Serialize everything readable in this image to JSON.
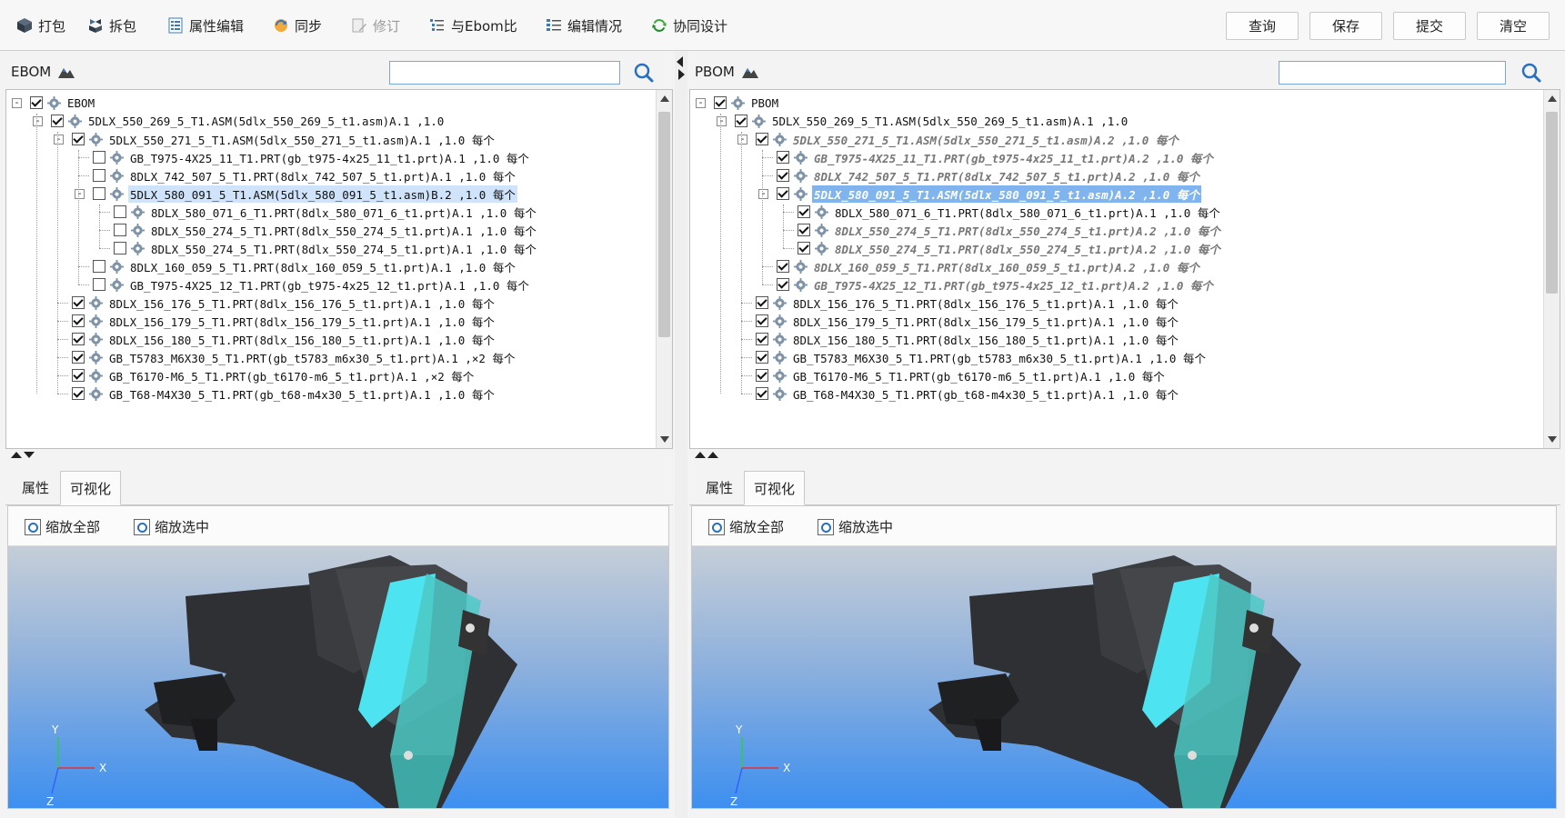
{
  "toolbar": {
    "items": [
      {
        "label": "打包",
        "icon": "package-icon"
      },
      {
        "label": "拆包",
        "icon": "unpack-icon"
      },
      {
        "label": "属性编辑",
        "icon": "property-edit-icon"
      },
      {
        "label": "同步",
        "icon": "sync-icon"
      },
      {
        "label": "修订",
        "icon": "revise-icon",
        "disabled": true
      },
      {
        "label": "与Ebom比",
        "icon": "compare-icon"
      },
      {
        "label": "编辑情况",
        "icon": "edit-status-icon"
      },
      {
        "label": "协同设计",
        "icon": "collab-icon"
      }
    ],
    "actions": {
      "query": "查询",
      "save": "保存",
      "submit": "提交",
      "clear": "清空"
    }
  },
  "left": {
    "title": "EBOM",
    "search_value": "",
    "tabs": {
      "props": "属性",
      "visual": "可视化"
    },
    "zoom_all": "缩放全部",
    "zoom_selected": "缩放选中",
    "axes": {
      "x": "X",
      "y": "Y",
      "z": "Z"
    },
    "rows": [
      {
        "text": "EBOM",
        "level": 0,
        "checked": true,
        "exp": "-"
      },
      {
        "text": "5DLX_550_269_5_T1.ASM(5dlx_550_269_5_t1.asm)A.1 ,1.0",
        "level": 1,
        "checked": true,
        "exp": "-"
      },
      {
        "text": "5DLX_550_271_5_T1.ASM(5dlx_550_271_5_t1.asm)A.1 ,1.0 每个",
        "level": 2,
        "checked": true,
        "exp": "-"
      },
      {
        "text": "GB_T975-4X25_11_T1.PRT(gb_t975-4x25_11_t1.prt)A.1 ,1.0 每个",
        "level": 3,
        "checked": false
      },
      {
        "text": "8DLX_742_507_5_T1.PRT(8dlx_742_507_5_t1.prt)A.1 ,1.0 每个",
        "level": 3,
        "checked": false
      },
      {
        "text": "5DLX_580_091_5_T1.ASM(5dlx_580_091_5_t1.asm)B.2 ,1.0 每个",
        "level": 3,
        "checked": false,
        "exp": "-",
        "selected": true
      },
      {
        "text": "8DLX_580_071_6_T1.PRT(8dlx_580_071_6_t1.prt)A.1 ,1.0 每个",
        "level": 4,
        "checked": false
      },
      {
        "text": "8DLX_550_274_5_T1.PRT(8dlx_550_274_5_t1.prt)A.1 ,1.0 每个",
        "level": 4,
        "checked": false
      },
      {
        "text": "8DLX_550_274_5_T1.PRT(8dlx_550_274_5_t1.prt)A.1 ,1.0 每个",
        "level": 4,
        "checked": false
      },
      {
        "text": "8DLX_160_059_5_T1.PRT(8dlx_160_059_5_t1.prt)A.1 ,1.0 每个",
        "level": 3,
        "checked": false
      },
      {
        "text": "GB_T975-4X25_12_T1.PRT(gb_t975-4x25_12_t1.prt)A.1 ,1.0 每个",
        "level": 3,
        "checked": false
      },
      {
        "text": "8DLX_156_176_5_T1.PRT(8dlx_156_176_5_t1.prt)A.1 ,1.0 每个",
        "level": 2,
        "checked": true
      },
      {
        "text": "8DLX_156_179_5_T1.PRT(8dlx_156_179_5_t1.prt)A.1 ,1.0 每个",
        "level": 2,
        "checked": true
      },
      {
        "text": "8DLX_156_180_5_T1.PRT(8dlx_156_180_5_t1.prt)A.1 ,1.0 每个",
        "level": 2,
        "checked": true
      },
      {
        "text": "GB_T5783_M6X30_5_T1.PRT(gb_t5783_m6x30_5_t1.prt)A.1 ,×2 每个",
        "level": 2,
        "checked": true
      },
      {
        "text": "GB_T6170-M6_5_T1.PRT(gb_t6170-m6_5_t1.prt)A.1 ,×2 每个",
        "level": 2,
        "checked": true
      },
      {
        "text": "GB_T68-M4X30_5_T1.PRT(gb_t68-m4x30_5_t1.prt)A.1 ,1.0 每个",
        "level": 2,
        "checked": true
      }
    ]
  },
  "right": {
    "title": "PBOM",
    "search_value": "",
    "tabs": {
      "props": "属性",
      "visual": "可视化"
    },
    "zoom_all": "缩放全部",
    "zoom_selected": "缩放选中",
    "axes": {
      "x": "X",
      "y": "Y",
      "z": "Z"
    },
    "rows": [
      {
        "text": "PBOM",
        "level": 0,
        "checked": true,
        "exp": "-"
      },
      {
        "text": "5DLX_550_269_5_T1.ASM(5dlx_550_269_5_t1.asm)A.1 ,1.0",
        "level": 1,
        "checked": true,
        "exp": "-"
      },
      {
        "text": "5DLX_550_271_5_T1.ASM(5dlx_550_271_5_t1.asm)A.2 ,1.0 每个",
        "level": 2,
        "checked": true,
        "exp": "-",
        "changed": true
      },
      {
        "text": "GB_T975-4X25_11_T1.PRT(gb_t975-4x25_11_t1.prt)A.2 ,1.0 每个",
        "level": 3,
        "checked": true,
        "changed": true
      },
      {
        "text": "8DLX_742_507_5_T1.PRT(8dlx_742_507_5_t1.prt)A.2 ,1.0 每个",
        "level": 3,
        "checked": true,
        "changed": true
      },
      {
        "text": "5DLX_580_091_5_T1.ASM(5dlx_580_091_5_t1.asm)A.2 ,1.0 每个",
        "level": 3,
        "checked": true,
        "exp": "-",
        "changed": true,
        "selected": true
      },
      {
        "text": "8DLX_580_071_6_T1.PRT(8dlx_580_071_6_t1.prt)A.1 ,1.0 每个",
        "level": 4,
        "checked": true
      },
      {
        "text": "8DLX_550_274_5_T1.PRT(8dlx_550_274_5_t1.prt)A.2 ,1.0 每个",
        "level": 4,
        "checked": true,
        "changed": true
      },
      {
        "text": "8DLX_550_274_5_T1.PRT(8dlx_550_274_5_t1.prt)A.2 ,1.0 每个",
        "level": 4,
        "checked": true,
        "changed": true
      },
      {
        "text": "8DLX_160_059_5_T1.PRT(8dlx_160_059_5_t1.prt)A.2 ,1.0 每个",
        "level": 3,
        "checked": true,
        "changed": true
      },
      {
        "text": "GB_T975-4X25_12_T1.PRT(gb_t975-4x25_12_t1.prt)A.2 ,1.0 每个",
        "level": 3,
        "checked": true,
        "changed": true
      },
      {
        "text": "8DLX_156_176_5_T1.PRT(8dlx_156_176_5_t1.prt)A.1 ,1.0 每个",
        "level": 2,
        "checked": true
      },
      {
        "text": "8DLX_156_179_5_T1.PRT(8dlx_156_179_5_t1.prt)A.1 ,1.0 每个",
        "level": 2,
        "checked": true
      },
      {
        "text": "8DLX_156_180_5_T1.PRT(8dlx_156_180_5_t1.prt)A.1 ,1.0 每个",
        "level": 2,
        "checked": true
      },
      {
        "text": "GB_T5783_M6X30_5_T1.PRT(gb_t5783_m6x30_5_t1.prt)A.1 ,1.0 每个",
        "level": 2,
        "checked": true
      },
      {
        "text": "GB_T6170-M6_5_T1.PRT(gb_t6170-m6_5_t1.prt)A.1 ,1.0 每个",
        "level": 2,
        "checked": true
      },
      {
        "text": "GB_T68-M4X30_5_T1.PRT(gb_t68-m4x30_5_t1.prt)A.1 ,1.0 每个",
        "level": 2,
        "checked": true
      }
    ]
  }
}
